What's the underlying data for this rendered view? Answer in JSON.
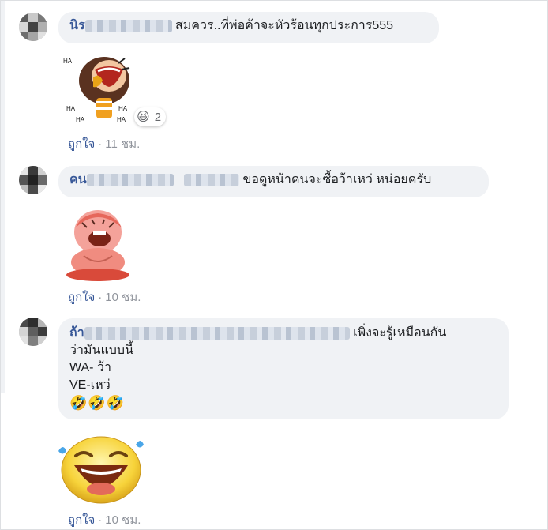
{
  "comments": [
    {
      "author_visible": "นิร",
      "text": "สมควร..ที่พ่อค้าจะหัวร้อนทุกประการ555",
      "reaction_icon": "haha-emoji",
      "reaction_count": "2",
      "like_label": "ถูกใจ",
      "separator": "·",
      "time": "11 ชม."
    },
    {
      "author_visible": "คน",
      "text": "ขอดูหน้าคนจะซื้อว้าเหว่ หน่อยครับ",
      "like_label": "ถูกใจ",
      "separator": "·",
      "time": "10 ชม."
    },
    {
      "author_visible": "ถ้า",
      "text_line1": "เพิ่งจะรู้เหมือนกัน",
      "text_line2": "ว่ามันแบบนี้",
      "text_line3": "WA- ว้า",
      "text_line4": "VE-เหว่",
      "emojis": "🤣🤣🤣",
      "like_label": "ถูกใจ",
      "separator": "·",
      "time": "10 ชม."
    }
  ],
  "colors": {
    "link": "#385898",
    "bubble": "#f0f2f5",
    "meta": "#90949c"
  }
}
